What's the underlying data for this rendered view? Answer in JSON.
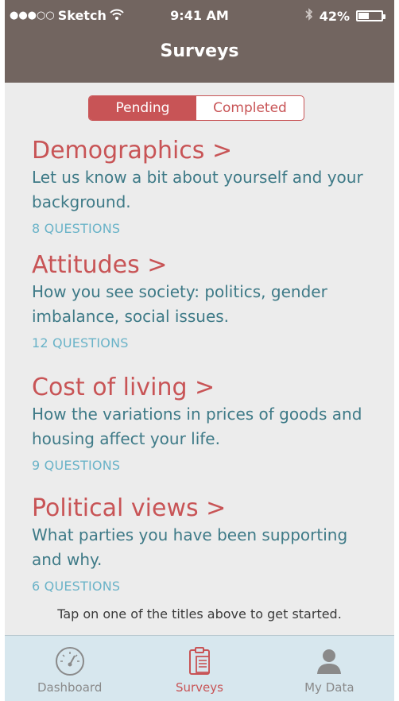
{
  "status_bar": {
    "signal_dots": "●●●○○",
    "carrier": "Sketch",
    "wifi_icon": "wifi-icon",
    "time": "9:41 AM",
    "bluetooth_icon": "bluetooth-icon",
    "battery_percent": "42%",
    "battery_level": 0.42
  },
  "nav": {
    "title": "Surveys"
  },
  "segments": [
    {
      "label": "Pending",
      "selected": true
    },
    {
      "label": "Completed",
      "selected": false
    }
  ],
  "surveys": [
    {
      "title": "Demographics  >",
      "description": "Let us know a bit about yourself and your background.",
      "count": "8 QUESTIONS"
    },
    {
      "title": "Attitudes >",
      "description": "How you see society: politics, gender imbalance, social issues.",
      "count": "12 QUESTIONS"
    },
    {
      "title": "Cost of living >",
      "description": "How the variations in prices of goods and housing affect your life.",
      "count": "9 QUESTIONS"
    },
    {
      "title": "Political views >",
      "description": "What parties you have been supporting and why.",
      "count": "6 QUESTIONS"
    }
  ],
  "hint": "Tap on one of the titles above to get started.",
  "tabs": [
    {
      "label": "Dashboard",
      "icon": "gauge-icon",
      "active": false
    },
    {
      "label": "Surveys",
      "icon": "clipboard-icon",
      "active": true
    },
    {
      "label": "My Data",
      "icon": "person-icon",
      "active": false
    }
  ],
  "colors": {
    "header": "#726560",
    "accent": "#c85456",
    "description": "#3e7a87",
    "count": "#6ab3c8",
    "background": "#ececec",
    "tabbar": "#d7e7ee"
  }
}
